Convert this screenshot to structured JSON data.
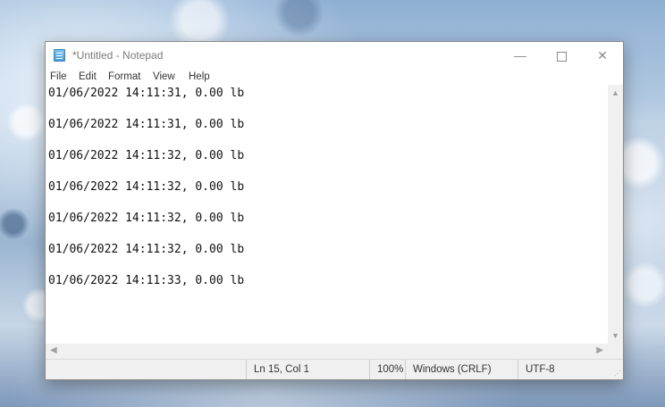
{
  "window": {
    "title": "*Untitled - Notepad",
    "minimize_symbol": "—",
    "close_symbol": "✕"
  },
  "menu": [
    "File",
    "Edit",
    "Format",
    "View",
    "Help"
  ],
  "editor_lines": [
    "01/06/2022 14:11:31, 0.00 lb",
    "01/06/2022 14:11:31, 0.00 lb",
    "01/06/2022 14:11:32, 0.00 lb",
    "01/06/2022 14:11:32, 0.00 lb",
    "01/06/2022 14:11:32, 0.00 lb",
    "01/06/2022 14:11:32, 0.00 lb",
    "01/06/2022 14:11:33, 0.00 lb"
  ],
  "statusbar": {
    "position": "Ln 15, Col 1",
    "zoom": "100%",
    "line_ending": "Windows (CRLF)",
    "encoding": "UTF-8"
  },
  "icons": {
    "app": "notepad-icon",
    "scroll_up": "chevron-up-icon",
    "scroll_down": "chevron-down-icon",
    "scroll_left": "chevron-left-icon",
    "scroll_right": "chevron-right-icon"
  }
}
